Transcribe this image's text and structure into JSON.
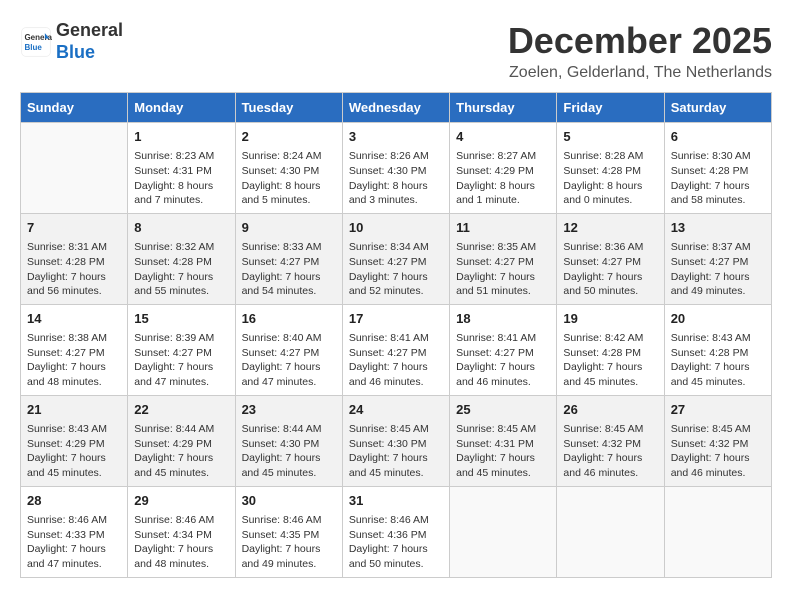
{
  "header": {
    "logo_line1": "General",
    "logo_line2": "Blue",
    "title": "December 2025",
    "subtitle": "Zoelen, Gelderland, The Netherlands"
  },
  "columns": [
    "Sunday",
    "Monday",
    "Tuesday",
    "Wednesday",
    "Thursday",
    "Friday",
    "Saturday"
  ],
  "weeks": [
    [
      {
        "day": "",
        "info": ""
      },
      {
        "day": "1",
        "info": "Sunrise: 8:23 AM\nSunset: 4:31 PM\nDaylight: 8 hours\nand 7 minutes."
      },
      {
        "day": "2",
        "info": "Sunrise: 8:24 AM\nSunset: 4:30 PM\nDaylight: 8 hours\nand 5 minutes."
      },
      {
        "day": "3",
        "info": "Sunrise: 8:26 AM\nSunset: 4:30 PM\nDaylight: 8 hours\nand 3 minutes."
      },
      {
        "day": "4",
        "info": "Sunrise: 8:27 AM\nSunset: 4:29 PM\nDaylight: 8 hours\nand 1 minute."
      },
      {
        "day": "5",
        "info": "Sunrise: 8:28 AM\nSunset: 4:28 PM\nDaylight: 8 hours\nand 0 minutes."
      },
      {
        "day": "6",
        "info": "Sunrise: 8:30 AM\nSunset: 4:28 PM\nDaylight: 7 hours\nand 58 minutes."
      }
    ],
    [
      {
        "day": "7",
        "info": "Sunrise: 8:31 AM\nSunset: 4:28 PM\nDaylight: 7 hours\nand 56 minutes."
      },
      {
        "day": "8",
        "info": "Sunrise: 8:32 AM\nSunset: 4:28 PM\nDaylight: 7 hours\nand 55 minutes."
      },
      {
        "day": "9",
        "info": "Sunrise: 8:33 AM\nSunset: 4:27 PM\nDaylight: 7 hours\nand 54 minutes."
      },
      {
        "day": "10",
        "info": "Sunrise: 8:34 AM\nSunset: 4:27 PM\nDaylight: 7 hours\nand 52 minutes."
      },
      {
        "day": "11",
        "info": "Sunrise: 8:35 AM\nSunset: 4:27 PM\nDaylight: 7 hours\nand 51 minutes."
      },
      {
        "day": "12",
        "info": "Sunrise: 8:36 AM\nSunset: 4:27 PM\nDaylight: 7 hours\nand 50 minutes."
      },
      {
        "day": "13",
        "info": "Sunrise: 8:37 AM\nSunset: 4:27 PM\nDaylight: 7 hours\nand 49 minutes."
      }
    ],
    [
      {
        "day": "14",
        "info": "Sunrise: 8:38 AM\nSunset: 4:27 PM\nDaylight: 7 hours\nand 48 minutes."
      },
      {
        "day": "15",
        "info": "Sunrise: 8:39 AM\nSunset: 4:27 PM\nDaylight: 7 hours\nand 47 minutes."
      },
      {
        "day": "16",
        "info": "Sunrise: 8:40 AM\nSunset: 4:27 PM\nDaylight: 7 hours\nand 47 minutes."
      },
      {
        "day": "17",
        "info": "Sunrise: 8:41 AM\nSunset: 4:27 PM\nDaylight: 7 hours\nand 46 minutes."
      },
      {
        "day": "18",
        "info": "Sunrise: 8:41 AM\nSunset: 4:27 PM\nDaylight: 7 hours\nand 46 minutes."
      },
      {
        "day": "19",
        "info": "Sunrise: 8:42 AM\nSunset: 4:28 PM\nDaylight: 7 hours\nand 45 minutes."
      },
      {
        "day": "20",
        "info": "Sunrise: 8:43 AM\nSunset: 4:28 PM\nDaylight: 7 hours\nand 45 minutes."
      }
    ],
    [
      {
        "day": "21",
        "info": "Sunrise: 8:43 AM\nSunset: 4:29 PM\nDaylight: 7 hours\nand 45 minutes."
      },
      {
        "day": "22",
        "info": "Sunrise: 8:44 AM\nSunset: 4:29 PM\nDaylight: 7 hours\nand 45 minutes."
      },
      {
        "day": "23",
        "info": "Sunrise: 8:44 AM\nSunset: 4:30 PM\nDaylight: 7 hours\nand 45 minutes."
      },
      {
        "day": "24",
        "info": "Sunrise: 8:45 AM\nSunset: 4:30 PM\nDaylight: 7 hours\nand 45 minutes."
      },
      {
        "day": "25",
        "info": "Sunrise: 8:45 AM\nSunset: 4:31 PM\nDaylight: 7 hours\nand 45 minutes."
      },
      {
        "day": "26",
        "info": "Sunrise: 8:45 AM\nSunset: 4:32 PM\nDaylight: 7 hours\nand 46 minutes."
      },
      {
        "day": "27",
        "info": "Sunrise: 8:45 AM\nSunset: 4:32 PM\nDaylight: 7 hours\nand 46 minutes."
      }
    ],
    [
      {
        "day": "28",
        "info": "Sunrise: 8:46 AM\nSunset: 4:33 PM\nDaylight: 7 hours\nand 47 minutes."
      },
      {
        "day": "29",
        "info": "Sunrise: 8:46 AM\nSunset: 4:34 PM\nDaylight: 7 hours\nand 48 minutes."
      },
      {
        "day": "30",
        "info": "Sunrise: 8:46 AM\nSunset: 4:35 PM\nDaylight: 7 hours\nand 49 minutes."
      },
      {
        "day": "31",
        "info": "Sunrise: 8:46 AM\nSunset: 4:36 PM\nDaylight: 7 hours\nand 50 minutes."
      },
      {
        "day": "",
        "info": ""
      },
      {
        "day": "",
        "info": ""
      },
      {
        "day": "",
        "info": ""
      }
    ]
  ]
}
